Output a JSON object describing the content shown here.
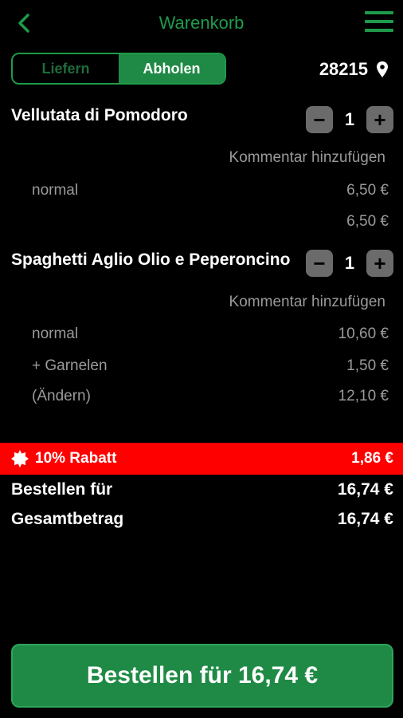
{
  "header": {
    "title": "Warenkorb",
    "back_icon": "chevron-left-icon",
    "menu_icon": "hamburger-menu-icon",
    "accent": "#1f9a4a"
  },
  "delivery_toggle": {
    "options": [
      "Liefern",
      "Abholen"
    ],
    "selected": "Abholen"
  },
  "location": {
    "zip": "28215",
    "icon": "location-pin-icon"
  },
  "items": [
    {
      "name": "Vellutata di Pomodoro",
      "quantity": "1",
      "comment_label": "Kommentar hinzufügen",
      "lines": [
        {
          "label": "normal",
          "price": "6,50 €"
        },
        {
          "label": "",
          "price": "6,50 €"
        }
      ]
    },
    {
      "name": "Spaghetti Aglio Olio e Peperoncino",
      "quantity": "1",
      "comment_label": "Kommentar hinzufügen",
      "lines": [
        {
          "label": "normal",
          "price": "10,60 €"
        },
        {
          "label": "+ Garnelen",
          "price": "1,50 €"
        },
        {
          "label": "(Ändern)",
          "price": "12,10 €"
        }
      ]
    }
  ],
  "stepper": {
    "minus": "−",
    "plus": "+"
  },
  "discount": {
    "label": "10% Rabatt",
    "amount": "1,86 €",
    "color": "#ff0000",
    "icon": "discount-badge-icon"
  },
  "totals": {
    "order_label": "Bestellen für",
    "order_amount": "16,74 €",
    "total_label": "Gesamtbetrag",
    "total_amount": "16,74 €"
  },
  "cta": {
    "label": "Bestellen für 16,74 €",
    "color": "#1f8a45"
  }
}
